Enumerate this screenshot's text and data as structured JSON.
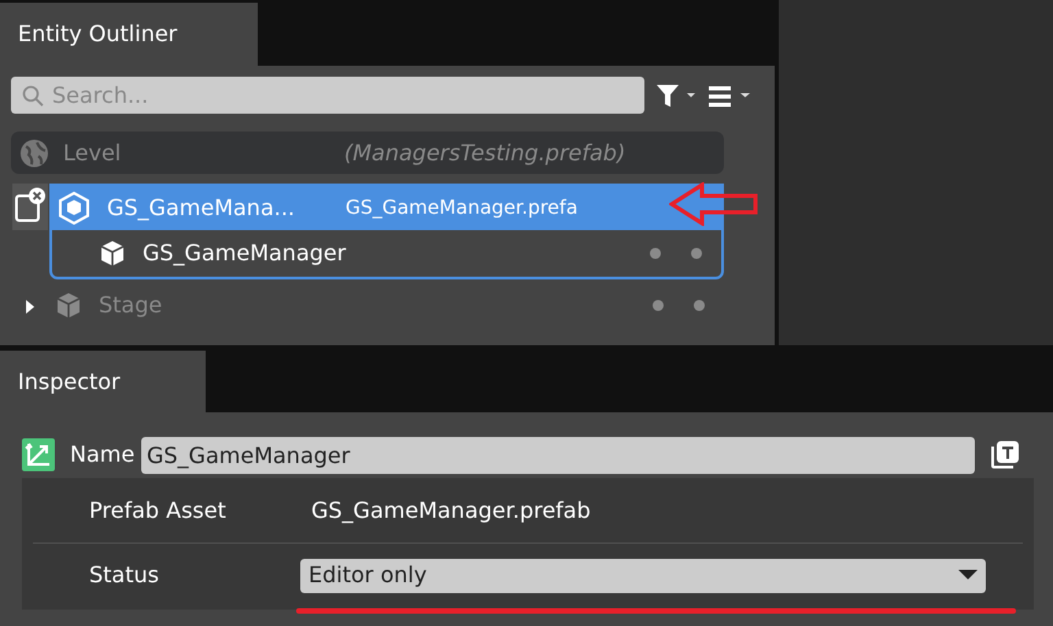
{
  "outliner": {
    "tab": {
      "label": "Entity Outliner",
      "selected": true
    },
    "search": {
      "placeholder": "Search..."
    },
    "level": {
      "name": "Level",
      "file": "(ManagersTesting.prefab)"
    },
    "rows": [
      {
        "name": "GS_GameMana...",
        "file": "GS_GameManager.prefa",
        "kind": "prefab",
        "selected": true,
        "expanded": true,
        "children": [
          {
            "name": "GS_GameManager",
            "kind": "entity",
            "selected": false,
            "dimmed": false
          }
        ]
      },
      {
        "name": "Stage",
        "kind": "entity",
        "selected": false,
        "expanded": false,
        "dimmed": true,
        "children": []
      }
    ]
  },
  "inspector": {
    "tab": {
      "label": "Inspector",
      "selected": true
    },
    "name_label": "Name",
    "name_value": "GS_GameManager",
    "fields": [
      {
        "label": "Prefab Asset",
        "value": "GS_GameManager.prefab",
        "kind": "text"
      },
      {
        "label": "Status",
        "value": "Editor only",
        "kind": "dropdown"
      }
    ]
  },
  "annotations": {
    "arrow": true,
    "underline": true
  }
}
